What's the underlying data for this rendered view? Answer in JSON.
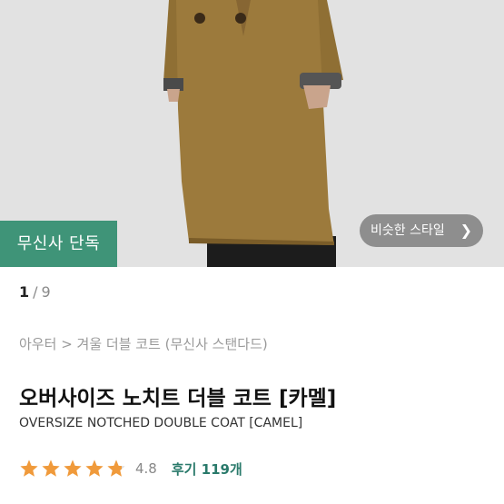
{
  "hero": {
    "badge_label": "무신사 단독",
    "similar_style_label": "비슷한 스타일",
    "colors": {
      "background": "#e2e2e2",
      "coat": "#9c7a3c",
      "badge": "#3f9478"
    }
  },
  "pager": {
    "current": "1",
    "separator": "/",
    "total": "9"
  },
  "breadcrumb": {
    "items": [
      "아우터",
      ">",
      "겨울 더블 코트 (무신사 스탠다드)"
    ]
  },
  "product": {
    "title_ko": "오버사이즈 노치트 더블 코트 [카멜]",
    "title_en": "OVERSIZE NOTCHED DOUBLE COAT [CAMEL]"
  },
  "rating": {
    "score": "4.8",
    "stars_value": 4.8,
    "stars_max": 5,
    "reviews_label": "후기 119개",
    "star_color": "#f09a3b"
  }
}
